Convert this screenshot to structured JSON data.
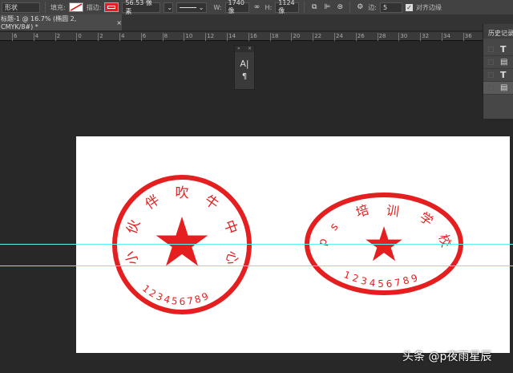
{
  "options_bar": {
    "tool": "形状",
    "fill_label": "填充:",
    "stroke_label": "描边:",
    "stroke_width": "56.53 像素",
    "w_label": "W:",
    "w_value": "1740 像",
    "h_label": "H:",
    "h_value": "1124 像",
    "edge_label": "边:",
    "edge_value": "5",
    "align_edges_label": "对齐边缘",
    "align_edges_checked": true
  },
  "document_tab": {
    "title": "标题-1 @ 16.7% (椭圆 2, CMYK/8#) *",
    "close": "×"
  },
  "ruler": {
    "labels": [
      "6",
      "4",
      "2",
      "0",
      "2",
      "4",
      "6",
      "8",
      "10",
      "12",
      "14",
      "16",
      "18",
      "20",
      "22",
      "24",
      "26",
      "28",
      "30",
      "32",
      "34",
      "36"
    ]
  },
  "history_panel": {
    "title": "历史记录",
    "items": [
      "T",
      "▤",
      "T",
      "▤"
    ]
  },
  "mini_panel": {
    "icons": [
      "A|",
      "¶"
    ]
  },
  "stamps": {
    "color": "#e51f1f",
    "round": {
      "text": [
        "小",
        "伙",
        "伴",
        "吹",
        "牛",
        "中",
        "心"
      ],
      "number": "123456789"
    },
    "oval": {
      "text": [
        "p",
        "s",
        "培",
        "训",
        "学",
        "校"
      ],
      "number": "123456789"
    }
  },
  "watermark": "头条 @p夜雨星辰"
}
